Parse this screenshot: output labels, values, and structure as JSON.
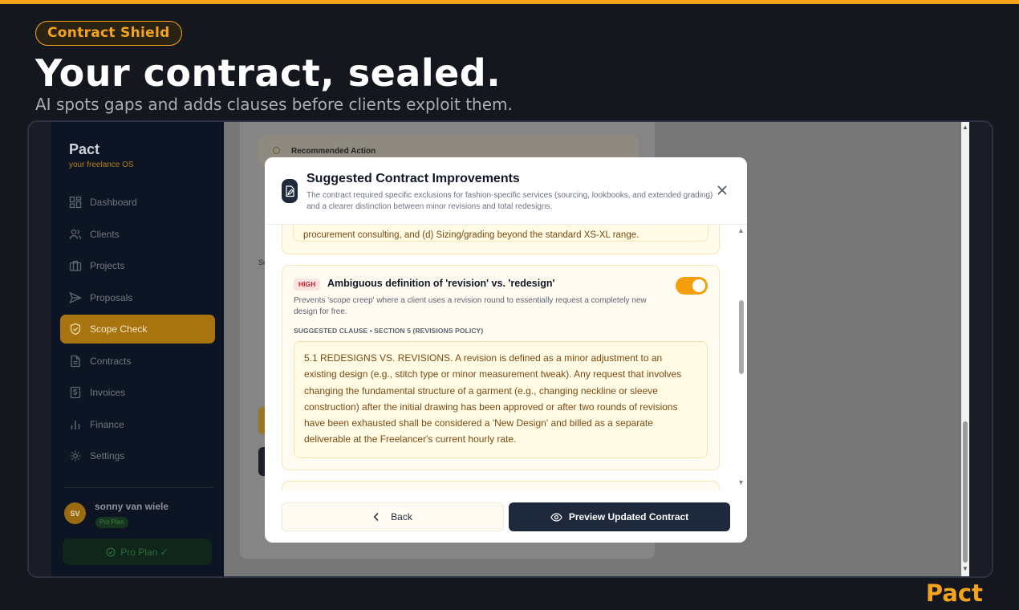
{
  "hero": {
    "badge": "Contract Shield",
    "title": "Your contract, sealed.",
    "subtitle": "AI spots gaps and adds clauses before clients exploit them.",
    "brand": "Pact"
  },
  "app": {
    "logo": "Pact",
    "logo_sub": "your freelance OS",
    "nav": [
      {
        "label": "Dashboard",
        "icon": "dashboard-icon"
      },
      {
        "label": "Clients",
        "icon": "users-icon"
      },
      {
        "label": "Projects",
        "icon": "briefcase-icon"
      },
      {
        "label": "Proposals",
        "icon": "send-icon"
      },
      {
        "label": "Scope Check",
        "icon": "shield-icon",
        "active": true
      },
      {
        "label": "Contracts",
        "icon": "document-icon"
      },
      {
        "label": "Invoices",
        "icon": "invoice-icon"
      },
      {
        "label": "Finance",
        "icon": "bar-chart-icon"
      },
      {
        "label": "Settings",
        "icon": "gear-icon"
      }
    ],
    "user": {
      "initials": "SV",
      "name": "sonny van wiele",
      "plan_badge": "Pro Plan"
    },
    "pro_button": "Pro Plan ✓",
    "background": {
      "recommended_label": "Recommended Action",
      "section_stub": "Su"
    }
  },
  "modal": {
    "title": "Suggested Contract Improvements",
    "description": "The contract required specific exclusions for fashion-specific services (sourcing, lookbooks, and extended grading) and a clearer distinction between minor revisions and total redesigns.",
    "previous_clause_tail": "procurement consulting, and (d) Sizing/grading beyond the standard XS-XL range.",
    "suggestion": {
      "severity": "HIGH",
      "title": "Ambiguous definition of 'revision' vs. 'redesign'",
      "description": "Prevents 'scope creep' where a client uses a revision round to essentially request a completely new design for free.",
      "enabled": true,
      "clause_label": "SUGGESTED CLAUSE • SECTION 5 (REVISIONS POLICY)",
      "clause_text": "5.1 REDESIGNS VS. REVISIONS. A revision is defined as a minor adjustment to an existing design (e.g., stitch type or minor measurement tweak). Any request that involves changing the fundamental structure of a garment (e.g., changing neckline or sleeve construction) after the initial drawing has been approved or after two rounds of revisions have been exhausted shall be considered a 'New Design' and billed as a separate deliverable at the Freelancer's current hourly rate."
    },
    "back_label": "Back",
    "preview_label": "Preview Updated Contract"
  },
  "colors": {
    "accent": "#f5a31a",
    "dark": "#1e293b",
    "severity_high": "#c8202a"
  }
}
